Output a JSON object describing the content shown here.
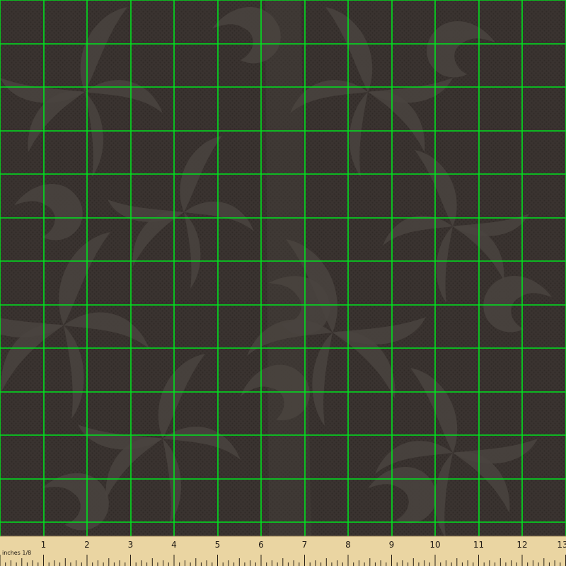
{
  "fabric": {
    "background_color": "#3a3330",
    "motif_color": "#4a4440",
    "texture_color": "#302a27",
    "grid_color": "#00e21e",
    "motif": "swirling damask leaf pattern"
  },
  "ruler": {
    "unit_label": "inches 1/8",
    "numbers": [
      "1",
      "2",
      "3",
      "4",
      "5",
      "6",
      "7",
      "8",
      "9",
      "10",
      "11",
      "12",
      "13"
    ],
    "background_color": "#ead5a2",
    "tick_color": "#2a2218"
  }
}
